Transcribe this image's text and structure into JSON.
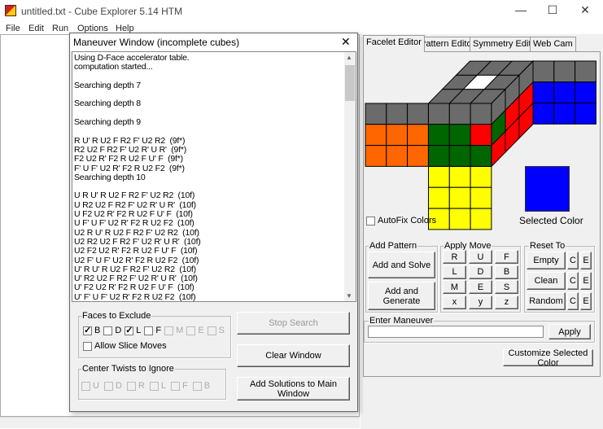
{
  "window": {
    "title": "untitled.txt - Cube Explorer 5.14 HTM",
    "minimize": "—",
    "maximize": "☐",
    "close": "✕"
  },
  "menu": [
    "File",
    "Edit",
    "Run",
    "Options",
    "Help"
  ],
  "tabs": [
    "Facelet Editor",
    "Pattern Editor",
    "Symmetry Editor",
    "Web Cam"
  ],
  "cube": {
    "colors": {
      "gray": "#6b6b6b",
      "white": "#ffffff",
      "orange": "#ff6600",
      "green": "#006600",
      "red": "#ff0000",
      "blue": "#0000ff",
      "yellow": "#ffff00"
    },
    "top": [
      [
        "gray",
        "gray",
        "gray"
      ],
      [
        "gray",
        "white",
        "gray"
      ],
      [
        "gray",
        "gray",
        "gray"
      ]
    ],
    "left": [
      [
        "gray",
        "gray",
        "gray"
      ],
      [
        "orange",
        "orange",
        "orange"
      ],
      [
        "orange",
        "orange",
        "orange"
      ]
    ],
    "front": [
      [
        "gray",
        "gray",
        "gray"
      ],
      [
        "green",
        "green",
        "red"
      ],
      [
        "green",
        "green",
        "green"
      ]
    ],
    "right": [
      [
        "gray",
        "gray",
        "gray"
      ],
      [
        "green",
        "red",
        "red"
      ],
      [
        "red",
        "red",
        "red"
      ]
    ],
    "back": [
      [
        "gray",
        "gray",
        "gray"
      ],
      [
        "blue",
        "blue",
        "blue"
      ],
      [
        "blue",
        "blue",
        "blue"
      ]
    ],
    "down": [
      [
        "yellow",
        "yellow",
        "yellow"
      ],
      [
        "yellow",
        "yellow",
        "yellow"
      ],
      [
        "yellow",
        "yellow",
        "yellow"
      ]
    ]
  },
  "autofix": {
    "label": "AutoFix Colors",
    "checked": false
  },
  "selected_color": {
    "label": "Selected Color",
    "value": "#0000ff"
  },
  "add_pattern": {
    "label": "Add Pattern",
    "solve": "Add and Solve",
    "generate": "Add and Generate"
  },
  "apply_move": {
    "label": "Apply Move",
    "moves": [
      "R",
      "U",
      "F",
      "L",
      "D",
      "B",
      "M",
      "E",
      "S",
      "x",
      "y",
      "z"
    ]
  },
  "reset_to": {
    "label": "Reset To",
    "rows": [
      {
        "label": "Empty",
        "c": "C",
        "e": "E"
      },
      {
        "label": "Clean",
        "c": "C",
        "e": "E"
      },
      {
        "label": "Random",
        "c": "C",
        "e": "E"
      }
    ]
  },
  "enter_maneuver": {
    "label": "Enter Maneuver",
    "value": "",
    "apply": "Apply"
  },
  "customize": "Customize Selected Color",
  "dialog": {
    "title": "Maneuver Window (incomplete cubes)",
    "close": "✕",
    "log": [
      "Using D-Face accelerator table.",
      "computation started...",
      "",
      "Searching depth 7",
      "",
      "Searching depth 8",
      "",
      "Searching depth 9",
      "",
      "R U' R U2 F R2 F' U2 R2  (9f*)",
      "R2 U2 F R2 F' U2 R' U R'  (9f*)",
      "F2 U2 R' F2 R U2 F U' F  (9f*)",
      "F' U F' U2 R' F2 R U2 F2  (9f*)",
      "Searching depth 10",
      "",
      "U R U' R U2 F R2 F' U2 R2  (10f)",
      "U R2 U2 F R2 F' U2 R' U R'  (10f)",
      "U F2 U2 R' F2 R U2 F U' F  (10f)",
      "U F' U F' U2 R' F2 R U2 F2  (10f)",
      "U2 R U' R U2 F R2 F' U2 R2  (10f)",
      "U2 R2 U2 F R2 F' U2 R' U R'  (10f)",
      "U2 F2 U2 R' F2 R U2 F U' F  (10f)",
      "U2 F' U F' U2 R' F2 R U2 F2  (10f)",
      "U' R U' R U2 F R2 F' U2 R2  (10f)",
      "U' R2 U2 F R2 F' U2 R' U R'  (10f)",
      "U' F2 U2 R' F2 R U2 F U' F  (10f)",
      "U' F' U F' U2 R' F2 R U2 F2  (10f)"
    ],
    "faces_to_exclude": {
      "label": "Faces to Exclude",
      "items": [
        {
          "l": "B",
          "checked": true,
          "enabled": true
        },
        {
          "l": "D",
          "checked": false,
          "enabled": true
        },
        {
          "l": "L",
          "checked": true,
          "enabled": true
        },
        {
          "l": "F",
          "checked": false,
          "enabled": true
        },
        {
          "l": "M",
          "checked": false,
          "enabled": false
        },
        {
          "l": "E",
          "checked": false,
          "enabled": false
        },
        {
          "l": "S",
          "checked": false,
          "enabled": false
        }
      ],
      "slice": "Allow Slice Moves"
    },
    "center_twists": {
      "label": "Center Twists to Ignore",
      "items": [
        "U",
        "D",
        "R",
        "L",
        "F",
        "B"
      ]
    },
    "stop": "Stop Search",
    "clear": "Clear Window",
    "add_solutions": "Add Solutions to Main Window"
  }
}
